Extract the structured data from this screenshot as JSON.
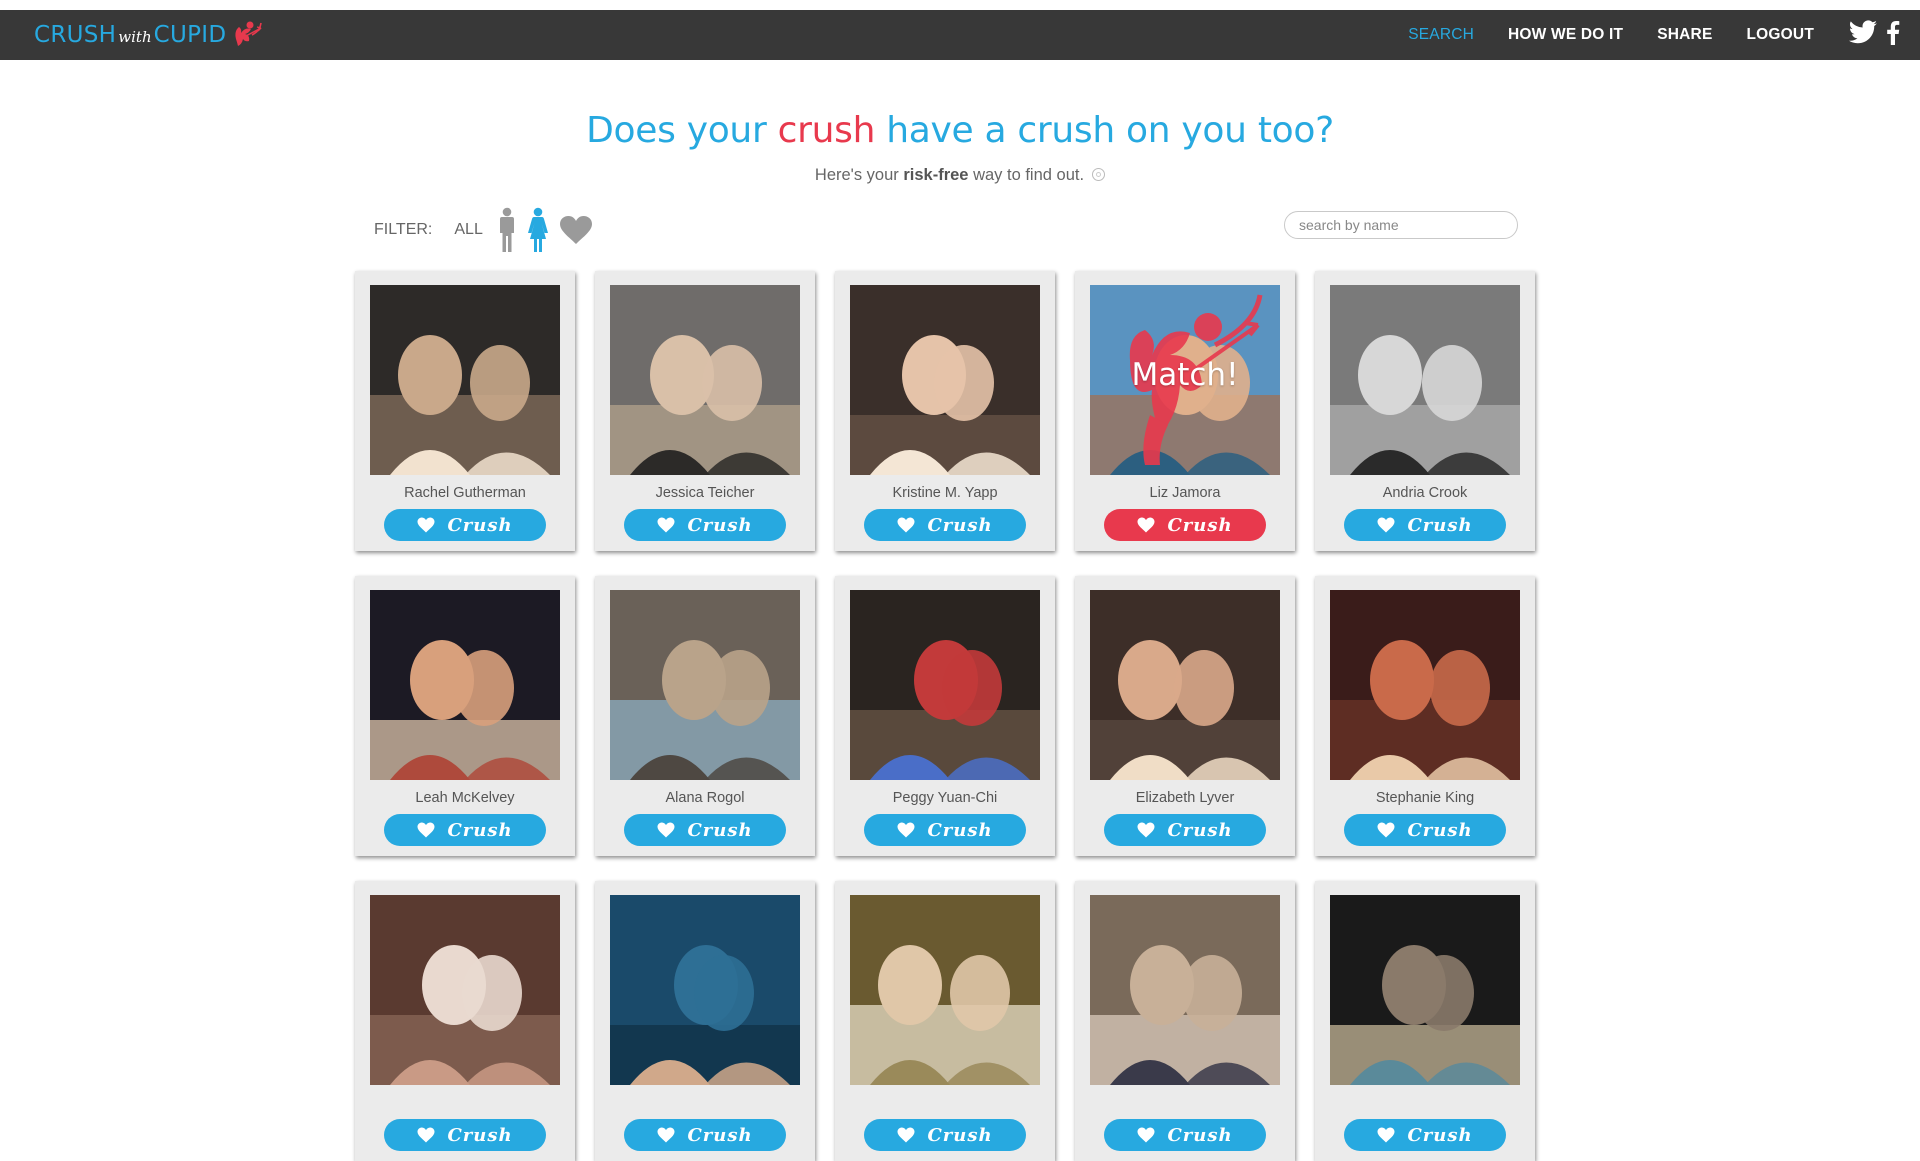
{
  "header": {
    "logo": {
      "part1": "CRUSH",
      "part2": "with",
      "part3": "CUPID"
    },
    "nav": [
      {
        "label": "SEARCH",
        "active": true
      },
      {
        "label": "HOW WE DO IT",
        "active": false
      },
      {
        "label": "SHARE",
        "active": false
      },
      {
        "label": "LOGOUT",
        "active": false
      }
    ],
    "social_icons": [
      "twitter-icon",
      "facebook-icon"
    ]
  },
  "hero": {
    "title_pre": "Does your ",
    "title_highlight": "crush",
    "title_post": " have a crush on you too?",
    "subtitle_pre": "Here's your ",
    "subtitle_bold": "risk-free",
    "subtitle_post": " way to find out."
  },
  "filter": {
    "label": "FILTER:",
    "all_label": "ALL",
    "options": [
      "male-icon",
      "female-icon",
      "heart-icon"
    ],
    "selected": "female-icon"
  },
  "search": {
    "placeholder": "search by name",
    "value": ""
  },
  "crush_label": "Crush",
  "match_label": "Match!",
  "colors": {
    "accent": "#27a9e0",
    "match": "#e8394d",
    "navbar": "#383838",
    "card": "#ebebeb"
  },
  "people": [
    {
      "name": "Rachel Gutherman",
      "matched": false
    },
    {
      "name": "Jessica Teicher",
      "matched": false
    },
    {
      "name": "Kristine M. Yapp",
      "matched": false
    },
    {
      "name": "Liz Jamora",
      "matched": true
    },
    {
      "name": "Andria Crook",
      "matched": false
    },
    {
      "name": "Leah McKelvey",
      "matched": false
    },
    {
      "name": "Alana Rogol",
      "matched": false
    },
    {
      "name": "Peggy Yuan-Chi",
      "matched": false
    },
    {
      "name": "Elizabeth Lyver",
      "matched": false
    },
    {
      "name": "Stephanie King",
      "matched": false
    },
    {
      "name": "",
      "matched": false
    },
    {
      "name": "",
      "matched": false
    },
    {
      "name": "",
      "matched": false
    },
    {
      "name": "",
      "matched": false
    },
    {
      "name": "",
      "matched": false
    }
  ]
}
